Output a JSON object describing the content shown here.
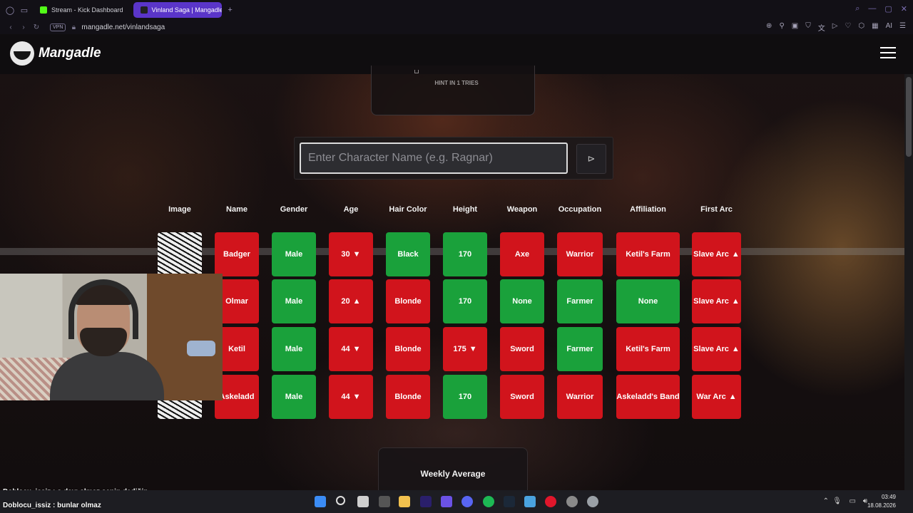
{
  "browser": {
    "tabs": [
      {
        "label": "Stream - Kick Dashboard",
        "active": false,
        "color": "#53fc18"
      },
      {
        "label": "Vinland Saga | Mangadle -",
        "active": true,
        "color": "#ffffff"
      }
    ],
    "url": "mangadle.net/vinlandsaga",
    "vpn_label": "VPN"
  },
  "site": {
    "logo_text": "Mangadle",
    "hint_text": "HINT IN 1 TRIES",
    "search_placeholder": "Enter Character Name (e.g. Ragnar)",
    "search_value": "",
    "submit_label": "⊳",
    "weekly_title": "Weekly Average"
  },
  "table": {
    "headers": [
      "Image",
      "Name",
      "Gender",
      "Age",
      "Hair Color",
      "Height",
      "Weapon",
      "Occupation",
      "Affiliation",
      "First Arc"
    ],
    "rows": [
      {
        "image": true,
        "cells": [
          {
            "text": "Badger",
            "status": "red",
            "arrow": ""
          },
          {
            "text": "Male",
            "status": "green",
            "arrow": ""
          },
          {
            "text": "30",
            "status": "red",
            "arrow": "▼"
          },
          {
            "text": "Black",
            "status": "green",
            "arrow": ""
          },
          {
            "text": "170",
            "status": "green",
            "arrow": ""
          },
          {
            "text": "Axe",
            "status": "red",
            "arrow": ""
          },
          {
            "text": "Warrior",
            "status": "red",
            "arrow": ""
          },
          {
            "text": "Ketil's Farm",
            "status": "red",
            "arrow": ""
          },
          {
            "text": "Slave Arc",
            "status": "red",
            "arrow": "▲"
          }
        ]
      },
      {
        "image": false,
        "cells": [
          {
            "text": "Olmar",
            "status": "red",
            "arrow": ""
          },
          {
            "text": "Male",
            "status": "green",
            "arrow": ""
          },
          {
            "text": "20",
            "status": "red",
            "arrow": "▲"
          },
          {
            "text": "Blonde",
            "status": "red",
            "arrow": ""
          },
          {
            "text": "170",
            "status": "green",
            "arrow": ""
          },
          {
            "text": "None",
            "status": "green",
            "arrow": ""
          },
          {
            "text": "Farmer",
            "status": "green",
            "arrow": ""
          },
          {
            "text": "None",
            "status": "green",
            "arrow": ""
          },
          {
            "text": "Slave Arc",
            "status": "red",
            "arrow": "▲"
          }
        ]
      },
      {
        "image": false,
        "cells": [
          {
            "text": "Ketil",
            "status": "red",
            "arrow": ""
          },
          {
            "text": "Male",
            "status": "green",
            "arrow": ""
          },
          {
            "text": "44",
            "status": "red",
            "arrow": "▼"
          },
          {
            "text": "Blonde",
            "status": "red",
            "arrow": ""
          },
          {
            "text": "175",
            "status": "red",
            "arrow": "▼"
          },
          {
            "text": "Sword",
            "status": "red",
            "arrow": ""
          },
          {
            "text": "Farmer",
            "status": "green",
            "arrow": ""
          },
          {
            "text": "Ketil's Farm",
            "status": "red",
            "arrow": ""
          },
          {
            "text": "Slave Arc",
            "status": "red",
            "arrow": "▲"
          }
        ]
      },
      {
        "image": true,
        "cells": [
          {
            "text": "Askeladd",
            "status": "red",
            "arrow": ""
          },
          {
            "text": "Male",
            "status": "green",
            "arrow": ""
          },
          {
            "text": "44",
            "status": "red",
            "arrow": "▼"
          },
          {
            "text": "Blonde",
            "status": "red",
            "arrow": ""
          },
          {
            "text": "170",
            "status": "green",
            "arrow": ""
          },
          {
            "text": "Sword",
            "status": "red",
            "arrow": ""
          },
          {
            "text": "Warrior",
            "status": "red",
            "arrow": ""
          },
          {
            "text": "Askeladd's Band",
            "status": "red",
            "arrow": ""
          },
          {
            "text": "War Arc",
            "status": "red",
            "arrow": "▲"
          }
        ]
      }
    ]
  },
  "chat": [
    {
      "user": "Doblocu_issiz",
      "message": "o dayı olmaz senin dediğin"
    },
    {
      "user": "Doblocu_issiz",
      "message": "bunlar olmaz"
    }
  ],
  "taskbar": {
    "time": "03:49",
    "date": "18.08.2026",
    "icons": [
      "windows-start-icon",
      "search-icon",
      "task-view-icon",
      "widgets-icon",
      "file-explorer-icon",
      "after-effects-icon",
      "brave-icon",
      "discord-icon",
      "spotify-icon",
      "steam-icon",
      "monitor-icon",
      "opera-gx-icon",
      "obs-icon",
      "settings-icon"
    ]
  },
  "colors": {
    "correct": "#1aa13b",
    "wrong": "#d1141c",
    "tab_active": "#5a35c9"
  }
}
